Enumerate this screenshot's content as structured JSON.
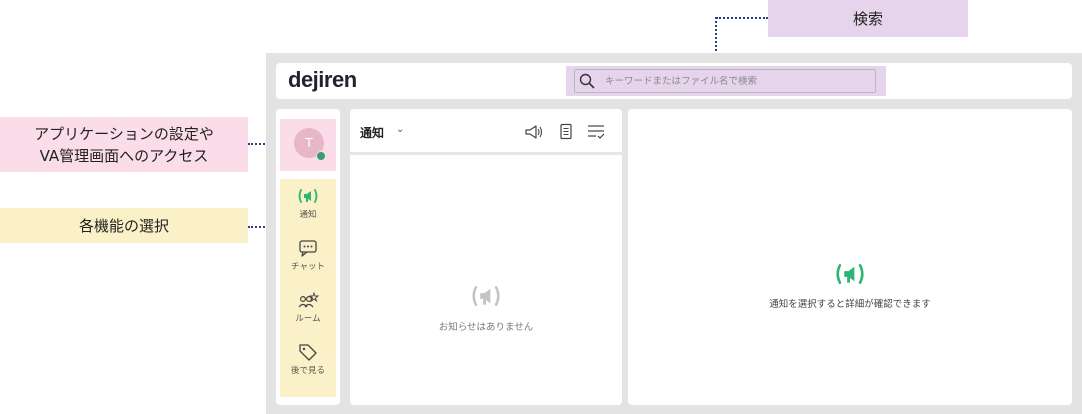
{
  "annotations": {
    "search": "検索",
    "settings_line1": "アプリケーションの設定や",
    "settings_line2": "VA管理画面へのアクセス",
    "features": "各機能の選択"
  },
  "header": {
    "logo": "dejiren",
    "search_placeholder": "キーワードまたはファイル名で検索"
  },
  "user": {
    "avatar_initial": "T",
    "status_color": "#3a9d72"
  },
  "sidebar": {
    "items": [
      {
        "label": "通知",
        "icon": "notification-icon",
        "active": true
      },
      {
        "label": "チャット",
        "icon": "chat-icon",
        "active": false
      },
      {
        "label": "ルーム",
        "icon": "room-icon",
        "active": false
      },
      {
        "label": "後で見る",
        "icon": "tag-icon",
        "active": false
      }
    ]
  },
  "notifications": {
    "title": "通知",
    "header_icons": [
      "megaphone-icon",
      "document-icon",
      "filter-list-icon"
    ],
    "empty_message": "お知らせはありません"
  },
  "detail": {
    "placeholder_message": "通知を選択すると詳細が確認できます"
  },
  "colors": {
    "accent_green": "#2bb673",
    "search_highlight": "#e6d4ec",
    "settings_highlight": "#fbdde9",
    "features_highlight": "#fbf1c8"
  }
}
